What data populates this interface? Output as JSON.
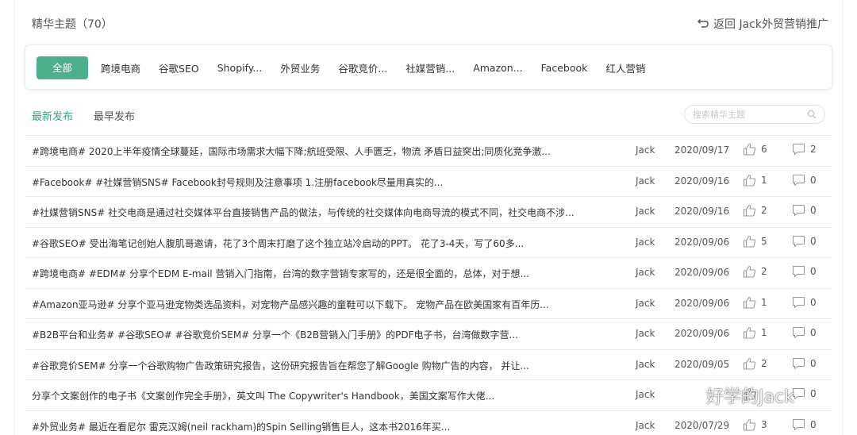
{
  "header": {
    "title": "精华主题（70）",
    "back_label": "返回 Jack外贸营销推广"
  },
  "categories": [
    {
      "label": "全部",
      "active": true
    },
    {
      "label": "跨境电商"
    },
    {
      "label": "谷歌SEO"
    },
    {
      "label": "Shopify..."
    },
    {
      "label": "外贸业务"
    },
    {
      "label": "谷歌竞价..."
    },
    {
      "label": "社媒营销..."
    },
    {
      "label": "Amazon..."
    },
    {
      "label": "Facebook"
    },
    {
      "label": "红人营销"
    }
  ],
  "tabs": [
    {
      "label": "最新发布",
      "active": true
    },
    {
      "label": "最早发布"
    }
  ],
  "search": {
    "placeholder": "搜索精华主题"
  },
  "posts": [
    {
      "title": "#跨境电商# 2020上半年疫情全球蔓延，国际市场需求大幅下降;航班受限、人手匮乏，物流 矛盾日益突出;同质化竞争激...",
      "author": "Jack",
      "date": "2020/09/17",
      "likes": "6",
      "comments": "2"
    },
    {
      "title": "#Facebook# #社媒营销SNS# Facebook封号规则及注意事项 1.注册facebook尽量用真实的...",
      "author": "Jack",
      "date": "2020/09/16",
      "likes": "1",
      "comments": "0"
    },
    {
      "title": "#社媒营销SNS# 社交电商是通过社交媒体平台直接销售产品的做法，与传统的社交媒体向电商导流的模式不同，社交电商不涉...",
      "author": "Jack",
      "date": "2020/09/16",
      "likes": "2",
      "comments": "0"
    },
    {
      "title": "#谷歌SEO# 受出海笔记创始人腹肌哥邀请，花了3个周末打磨了这个独立站冷启动的PPT。 花了3-4天，写了60多...",
      "author": "Jack",
      "date": "2020/09/06",
      "likes": "5",
      "comments": "0"
    },
    {
      "title": "#跨境电商# #EDM# 分享个EDM E-mail 营销入门指南，台湾的数字营销专家写的，还是很全面的，总体，对于想...",
      "author": "Jack",
      "date": "2020/09/06",
      "likes": "2",
      "comments": "0"
    },
    {
      "title": "#Amazon亚马逊# 分享个亚马逊宠物类选品资料，对宠物产品感兴趣的童鞋可以下载下。 宠物产品在欧美国家有百年历...",
      "author": "Jack",
      "date": "2020/09/06",
      "likes": "1",
      "comments": "0"
    },
    {
      "title": "#B2B平台和业务# #谷歌SEO# #谷歌竞价SEM# 分享一个《B2B营销入门手册》的PDF电子书，台湾做数字营...",
      "author": "Jack",
      "date": "2020/09/06",
      "likes": "1",
      "comments": "0"
    },
    {
      "title": "#谷歌竞价SEM# 分享一个谷歌购物广告政策研究报告，这份研究报告旨在帮您了解Google 购物广告的内容， 并让...",
      "author": "Jack",
      "date": "2020/09/05",
      "likes": "2",
      "comments": "0"
    },
    {
      "title": "分享个文案创作的电子书《文案创作完全手册》，英文叫 The Copywriter's Handbook，美国文案写作大佬...",
      "author": "Jack",
      "date": "",
      "likes": "",
      "comments": "0"
    },
    {
      "title": "#外贸业务# 最近在看尼尔 雷克汉姆(neil rackham)的Spin Selling销售巨人，这本书2016年买...",
      "author": "Jack",
      "date": "2020/07/29",
      "likes": "3",
      "comments": "0"
    }
  ],
  "watermark": {
    "text": "好学的Jack"
  }
}
